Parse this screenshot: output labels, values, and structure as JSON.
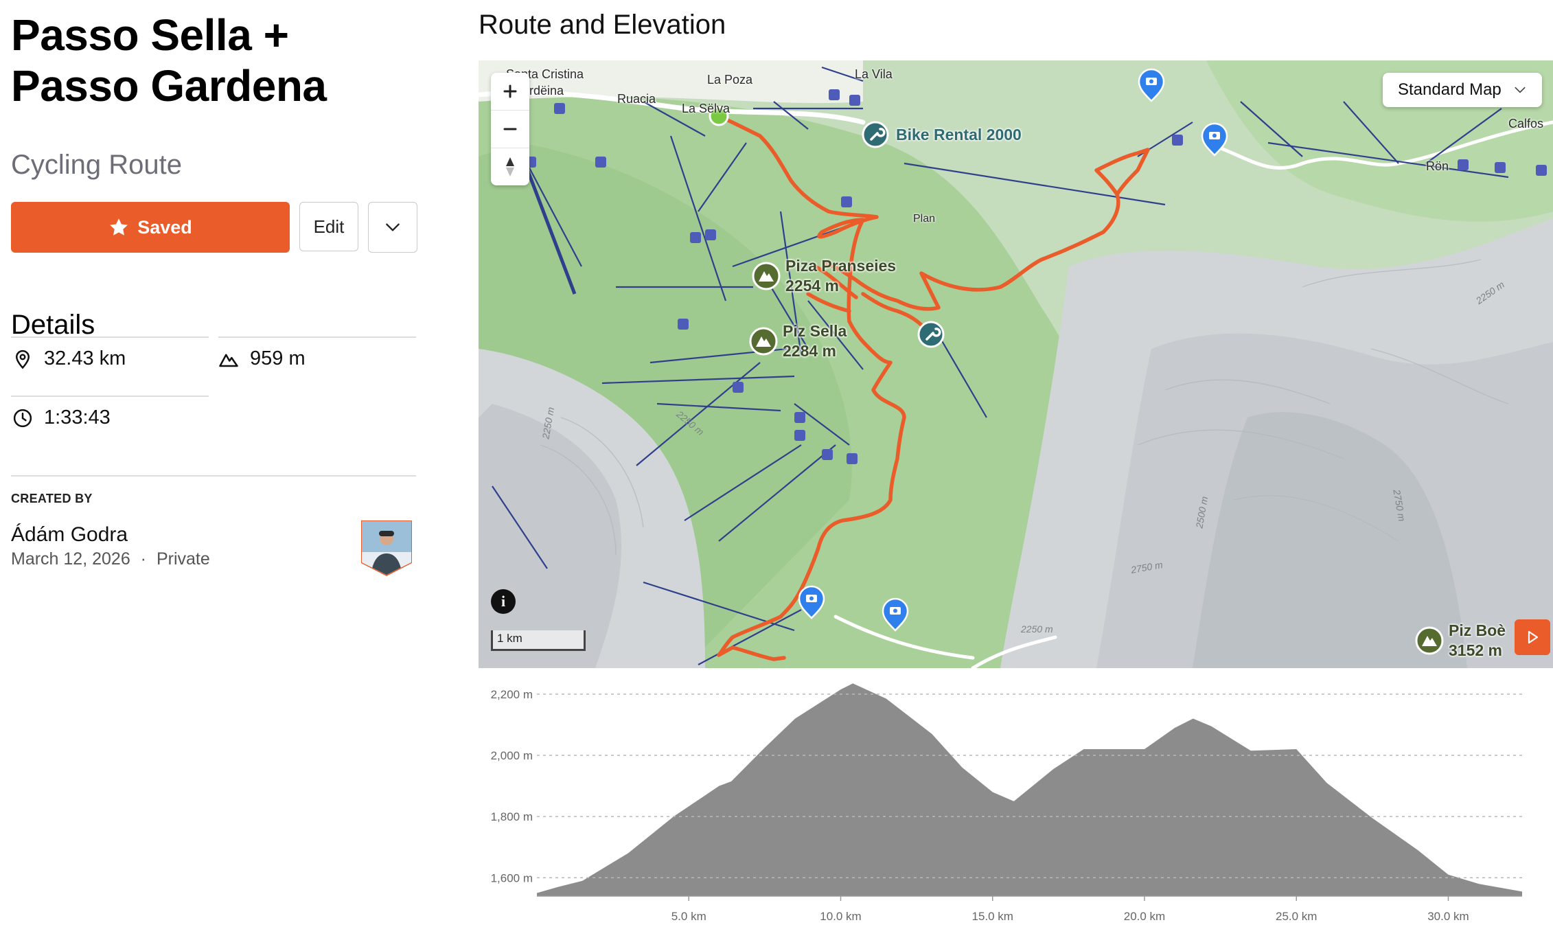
{
  "route": {
    "title": "Passo Sella + Passo Gardena",
    "type": "Cycling Route",
    "saved_label": "Saved",
    "edit_label": "Edit"
  },
  "details": {
    "heading": "Details",
    "distance": "32.43 km",
    "elevation_gain": "959 m",
    "duration": "1:33:43"
  },
  "creator": {
    "label": "CREATED BY",
    "name": "Ádám Godra",
    "date": "March 12, 2026",
    "separator": "·",
    "visibility": "Private"
  },
  "map": {
    "section_title": "Route and Elevation",
    "map_type": "Standard Map",
    "scale_label": "1 km",
    "info_label": "i",
    "route_color": "#ea5c2a",
    "start_marker_color": "#7ac943",
    "place_labels": [
      "Santa Cristina",
      "Gherdëina",
      "La Poza",
      "La Vila",
      "Ruacia",
      "La Sëlva",
      "Plan",
      "Calfos",
      "Rön"
    ],
    "pois": [
      {
        "name": "Bike Rental 2000",
        "icon": "wrench-icon"
      },
      {
        "name": "Piza Pranseies",
        "elevation": "2254 m",
        "icon": "mountain-icon"
      },
      {
        "name": "Piz Sella",
        "elevation": "2284 m",
        "icon": "mountain-icon"
      },
      {
        "name": "Piz Boè",
        "elevation": "3152 m",
        "icon": "mountain-icon"
      }
    ],
    "contour_labels": [
      "2250 m",
      "2250 m",
      "2250 m",
      "2500 m",
      "2750 m",
      "2750 m",
      "2250 m"
    ]
  },
  "chart_data": {
    "type": "area",
    "title": "",
    "xlabel": "",
    "ylabel": "",
    "x_unit": "km",
    "y_unit": "m",
    "xlim": [
      0,
      32.43
    ],
    "ylim": [
      1540,
      2240
    ],
    "y_ticks": [
      "2,200 m",
      "2,000 m",
      "1,800 m",
      "1,600 m"
    ],
    "y_tick_values": [
      2200,
      2000,
      1800,
      1600
    ],
    "x_ticks": [
      "5.0 km",
      "10.0 km",
      "15.0 km",
      "20.0 km",
      "25.0 km",
      "30.0 km"
    ],
    "x_tick_values": [
      5,
      10,
      15,
      20,
      25,
      30
    ],
    "fill_color": "#8c8c8c",
    "grid": "dashed horizontal",
    "series": [
      {
        "x": [
          0,
          0.7,
          1.5,
          3.0,
          4.5,
          6.0,
          6.4,
          7.5,
          8.5,
          10.0,
          10.4,
          11.5,
          13.0,
          14.0,
          15.0,
          15.7,
          17.0,
          18.0,
          20.0,
          21.0,
          21.6,
          22.2,
          23.5,
          25.0,
          26.0,
          27.5,
          29.0,
          30.0,
          31.0,
          32.43
        ],
        "y": [
          1550,
          1570,
          1590,
          1680,
          1800,
          1900,
          1915,
          2025,
          2120,
          2215,
          2235,
          2185,
          2070,
          1960,
          1880,
          1850,
          1955,
          2020,
          2020,
          2090,
          2120,
          2095,
          2015,
          2020,
          1910,
          1795,
          1690,
          1610,
          1580,
          1555
        ]
      }
    ]
  }
}
